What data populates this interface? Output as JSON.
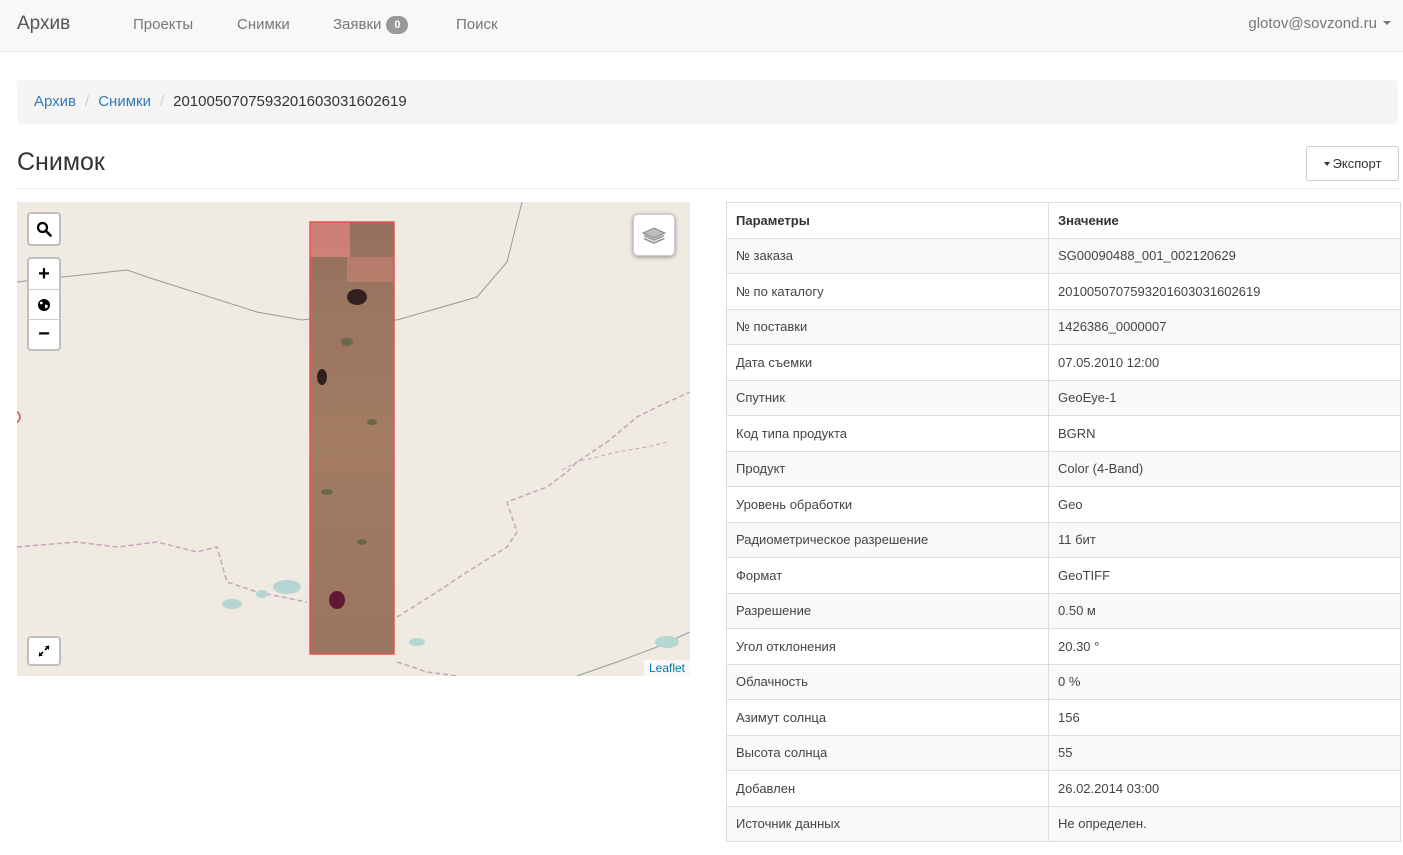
{
  "navbar": {
    "brand": "Архив",
    "items": [
      {
        "label": "Проекты"
      },
      {
        "label": "Снимки"
      },
      {
        "label": "Заявки",
        "badge": "0"
      },
      {
        "label": "Поиск"
      }
    ],
    "user": "glotov@sovzond.ru"
  },
  "breadcrumb": {
    "items": [
      "Архив",
      "Снимки"
    ],
    "active": "2010050707593201603031602619"
  },
  "page": {
    "title": "Снимок",
    "export_label": "Экспорт"
  },
  "map": {
    "attribution": "Leaflet",
    "controls": {
      "search_icon": "search-icon",
      "zoom_in": "+",
      "globe_icon": "globe-icon",
      "zoom_out": "−",
      "fullscreen_icon": "expand-icon",
      "layers_icon": "layers-icon"
    },
    "footprint_color": "#e8534f"
  },
  "table": {
    "headers": [
      "Параметры",
      "Значение"
    ],
    "rows": [
      [
        "№ заказа",
        "SG00090488_001_002120629"
      ],
      [
        "№ по каталогу",
        "2010050707593201603031602619"
      ],
      [
        "№ поставки",
        "1426386_0000007"
      ],
      [
        "Дата съемки",
        "07.05.2010 12:00"
      ],
      [
        "Спутник",
        "GeoEye-1"
      ],
      [
        "Код типа продукта",
        "BGRN"
      ],
      [
        "Продукт",
        "Color (4-Band)"
      ],
      [
        "Уровень обработки",
        "Geo"
      ],
      [
        "Радиометрическое разрешение",
        "11 бит"
      ],
      [
        "Формат",
        "GeoTIFF"
      ],
      [
        "Разрешение",
        "0.50 м"
      ],
      [
        "Угол отклонения",
        "20.30 °"
      ],
      [
        "Облачность",
        "0 %"
      ],
      [
        "Азимут солнца",
        "156"
      ],
      [
        "Высота солнца",
        "55"
      ],
      [
        "Добавлен",
        "26.02.2014 03:00"
      ],
      [
        "Источник данных",
        "Не определен."
      ]
    ]
  }
}
